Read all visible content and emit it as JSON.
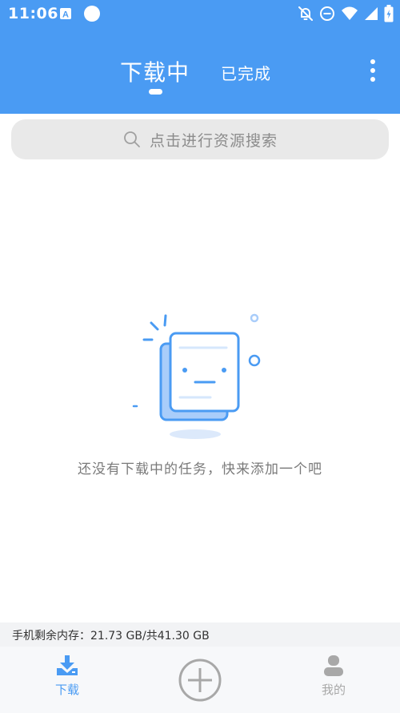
{
  "status_bar": {
    "time": "11:06"
  },
  "header": {
    "tabs": [
      {
        "label": "下载中",
        "active": true
      },
      {
        "label": "已完成",
        "active": false
      }
    ]
  },
  "search": {
    "placeholder": "点击进行资源搜索"
  },
  "empty_state": {
    "message": "还没有下载中的任务，快来添加一个吧"
  },
  "storage": {
    "label": "手机剩余内存：21.73 GB/共41.30 GB"
  },
  "bottom_nav": {
    "items": [
      {
        "label": "下载",
        "icon": "download-icon",
        "active": true
      },
      {
        "label": "",
        "icon": "add-circle-icon",
        "active": false
      },
      {
        "label": "我的",
        "icon": "user-icon",
        "active": false
      }
    ]
  },
  "colors": {
    "primary": "#4a9bf3",
    "inactive": "#a8a8a8",
    "text_muted": "#7a7a7a"
  }
}
